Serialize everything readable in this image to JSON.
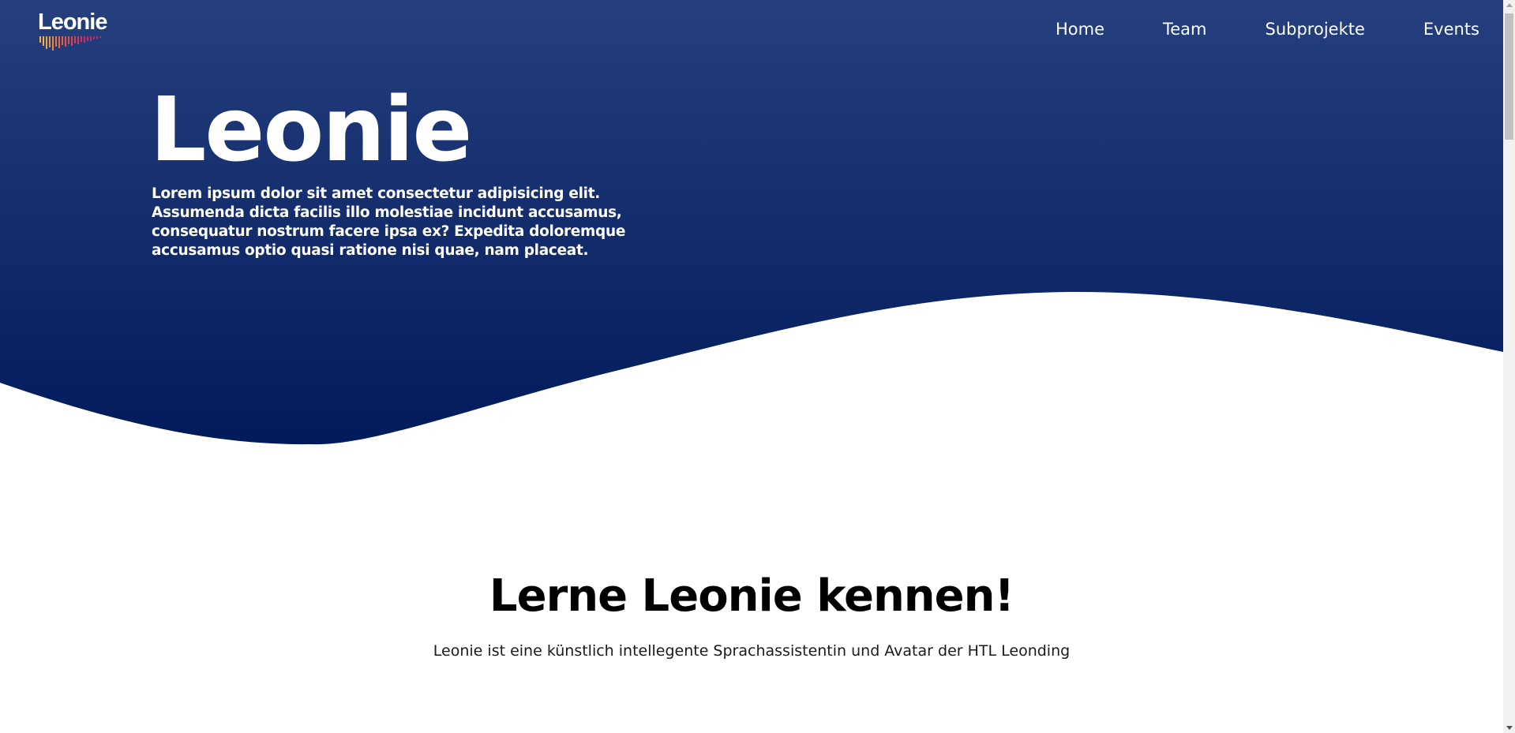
{
  "brand": {
    "logo_text": "Leonie",
    "primary_color": "#062060",
    "gradient_top": "#263f7e",
    "gradient_bottom": "#021b5c"
  },
  "nav": {
    "items": [
      {
        "label": "Home"
      },
      {
        "label": "Team"
      },
      {
        "label": "Subprojekte"
      },
      {
        "label": "Events"
      }
    ]
  },
  "hero": {
    "title": "Leonie",
    "text": "Lorem ipsum dolor sit amet consectetur adipisicing elit. Assumenda dicta facilis illo molestiae incidunt accusamus, consequatur nostrum facere ipsa ex? Expedita doloremque accusamus optio quasi ratione nisi quae, nam placeat."
  },
  "intro": {
    "title": "Lerne Leonie kennen!",
    "text": "Leonie ist eine künstlich intellegente Sprachassistentin und Avatar der HTL Leonding"
  }
}
